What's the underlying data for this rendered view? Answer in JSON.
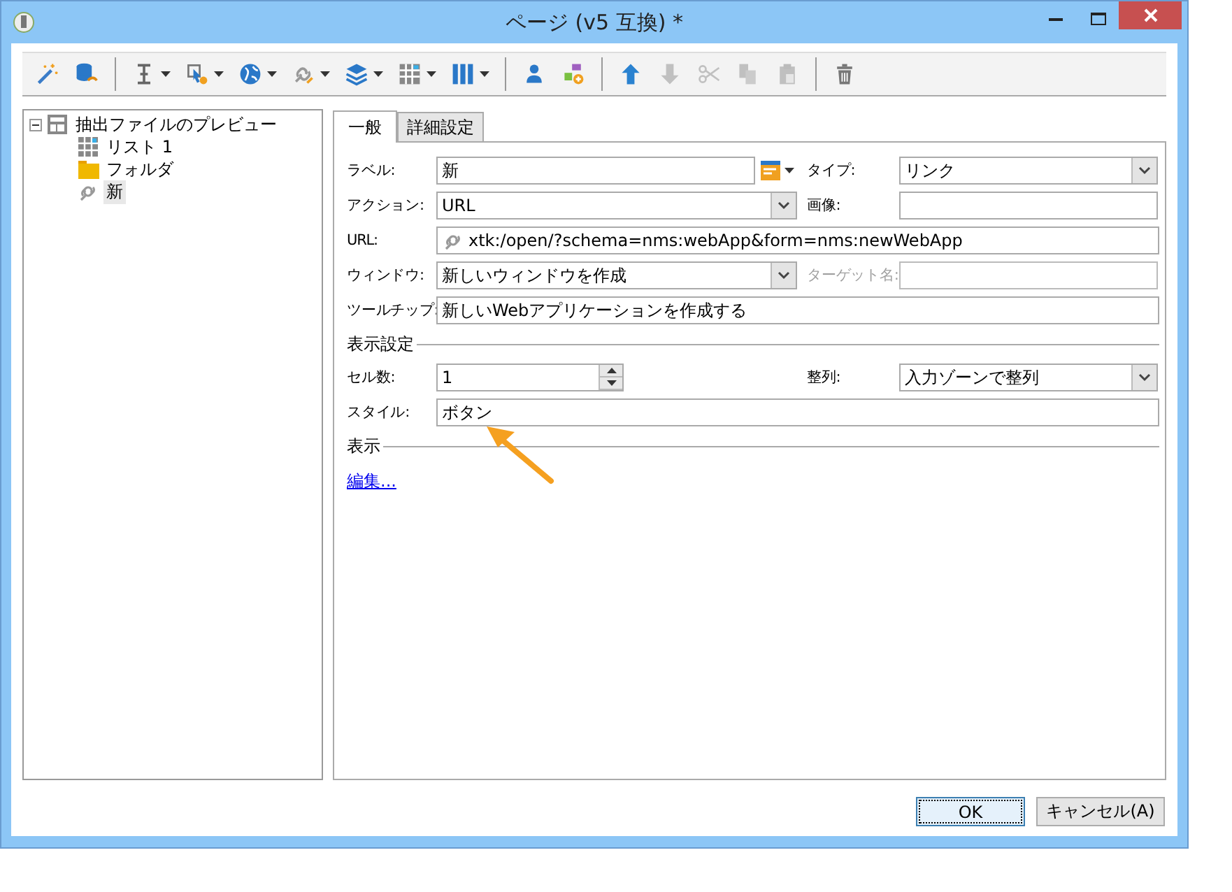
{
  "window": {
    "title": "ページ (v5 互換) *"
  },
  "toolbar": [
    {
      "kind": "wand",
      "dropdown": false,
      "disabled": false
    },
    {
      "kind": "database",
      "dropdown": false,
      "disabled": false
    },
    {
      "kind": "separator"
    },
    {
      "kind": "text-cursor",
      "dropdown": true,
      "disabled": false
    },
    {
      "kind": "pointer-gear",
      "dropdown": true,
      "disabled": false
    },
    {
      "kind": "globe",
      "dropdown": true,
      "disabled": false
    },
    {
      "kind": "link",
      "dropdown": true,
      "disabled": false
    },
    {
      "kind": "layers",
      "dropdown": true,
      "disabled": false
    },
    {
      "kind": "grid",
      "dropdown": true,
      "disabled": false
    },
    {
      "kind": "columns",
      "dropdown": true,
      "disabled": false
    },
    {
      "kind": "separator"
    },
    {
      "kind": "person",
      "dropdown": false,
      "disabled": false
    },
    {
      "kind": "shapes",
      "dropdown": false,
      "disabled": false
    },
    {
      "kind": "separator"
    },
    {
      "kind": "up",
      "dropdown": false,
      "disabled": false
    },
    {
      "kind": "down",
      "dropdown": false,
      "disabled": true
    },
    {
      "kind": "scissors",
      "dropdown": false,
      "disabled": true
    },
    {
      "kind": "copy",
      "dropdown": false,
      "disabled": true
    },
    {
      "kind": "paste",
      "dropdown": false,
      "disabled": true
    },
    {
      "kind": "separator"
    },
    {
      "kind": "trash",
      "dropdown": false,
      "disabled": false
    }
  ],
  "tree": [
    {
      "label": "抽出ファイルのプレビュー",
      "kind": "layout",
      "expanded": true,
      "selected": false,
      "children": [
        {
          "label": "リスト 1",
          "kind": "grid",
          "selected": false
        },
        {
          "label": "フォルダ",
          "kind": "folder",
          "selected": false
        },
        {
          "label": "新",
          "kind": "link",
          "selected": true
        }
      ]
    }
  ],
  "tabs": [
    {
      "label": "一般",
      "selected": true
    },
    {
      "label": "詳細設定",
      "selected": false
    }
  ],
  "form": {
    "label": {
      "label": "ラベル:",
      "value": "新"
    },
    "type": {
      "label": "タイプ:",
      "value": "リンク"
    },
    "action": {
      "label": "アクション:",
      "value": "URL"
    },
    "image": {
      "label": "画像:"
    },
    "url": {
      "label": "URL:",
      "value": "xtk:/open/?schema=nms:webApp&form=nms:newWebApp"
    },
    "window": {
      "label": "ウィンドウ:",
      "value": "新しいウィンドウを作成"
    },
    "target": {
      "label": "ターゲット名:",
      "disabled": true
    },
    "tooltip": {
      "label": "ツールチップ:",
      "value": "新しいWebアプリケーションを作成する"
    },
    "display_settings": {
      "heading": "表示設定"
    },
    "cells": {
      "label": "セル数:",
      "value": "1"
    },
    "align": {
      "label": "整列:",
      "value": "入力ゾーンで整列"
    },
    "style": {
      "label": "スタイル:",
      "value": "ボタン"
    },
    "display": {
      "heading": "表示"
    },
    "edit_link": "編集..."
  },
  "buttons": [
    {
      "label": "OK",
      "default": true
    },
    {
      "label": "キャンセル(A)",
      "default": false
    }
  ]
}
